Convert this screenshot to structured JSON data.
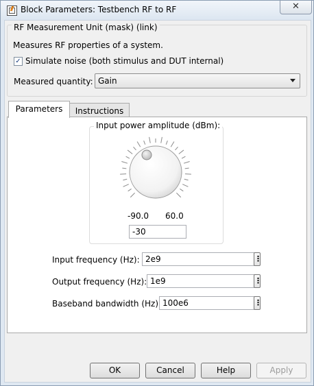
{
  "window": {
    "title": "Block Parameters: Testbench RF to RF",
    "close_glyph": "✕"
  },
  "mask": {
    "legend": "RF Measurement Unit (mask) (link)",
    "description": "Measures RF properties of a system.",
    "simulate_noise_label": "Simulate noise (both stimulus and DUT internal)",
    "simulate_noise_checked": true,
    "measured_quantity_label": "Measured quantity:",
    "measured_quantity_value": "Gain"
  },
  "tabs": [
    {
      "label": "Parameters",
      "active": true
    },
    {
      "label": "Instructions",
      "active": false
    }
  ],
  "parameters": {
    "dial": {
      "legend": "Input power amplitude (dBm):",
      "min_label": "-90.0",
      "max_label": "60.0",
      "value": "-30"
    },
    "input_frequency": {
      "label": "Input frequency (Hz):",
      "value": "2e9"
    },
    "output_frequency": {
      "label": "Output frequency (Hz):",
      "value": "1e9"
    },
    "baseband_bandwidth": {
      "label": "Baseband bandwidth (Hz):",
      "value": "100e6"
    },
    "more_glyph": "⋮"
  },
  "buttons": {
    "ok": "OK",
    "cancel": "Cancel",
    "help": "Help",
    "apply": "Apply"
  },
  "icons": [
    "app-icon",
    "close-icon",
    "checkbox-check-icon",
    "dropdown-arrow-icon",
    "dial-knob-icon",
    "more-options-icon"
  ]
}
